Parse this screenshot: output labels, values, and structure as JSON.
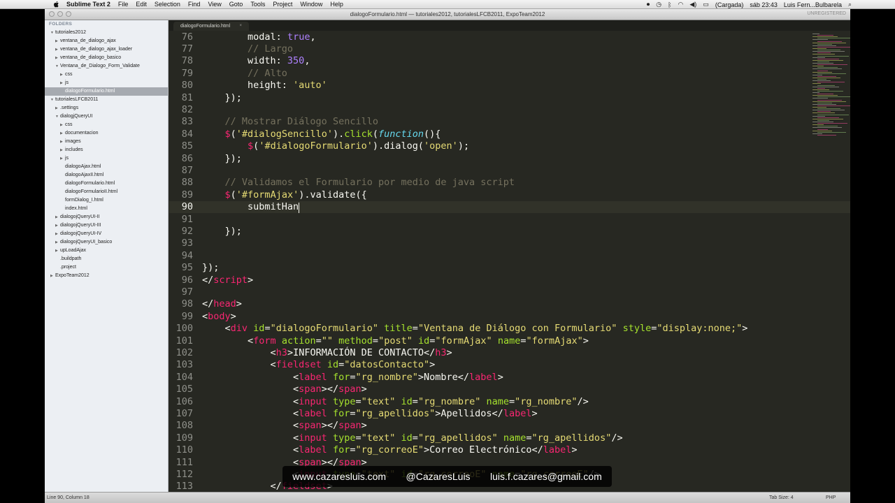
{
  "menubar": {
    "app": "Sublime Text 2",
    "items": [
      "File",
      "Edit",
      "Selection",
      "Find",
      "View",
      "Goto",
      "Tools",
      "Project",
      "Window",
      "Help"
    ],
    "battery": "(Cargada)",
    "clock": "sáb 23:43",
    "user": "Luis Fern...Bulbarela"
  },
  "window": {
    "title": "dialogoFormulario.html — tutoriales2012, tutorialesLFCB2011, ExpoTeam2012",
    "unregistered": "UNREGISTERED"
  },
  "sidebar": {
    "header": "FOLDERS",
    "items": [
      {
        "label": "tutoriales2012",
        "depth": 0,
        "open": true
      },
      {
        "label": "ventana_de_dialogo_ajax",
        "depth": 1,
        "open": false
      },
      {
        "label": "ventana_de_dialogo_ajax_loader",
        "depth": 1,
        "open": false
      },
      {
        "label": "ventana_de_dialogo_basico",
        "depth": 1,
        "open": false
      },
      {
        "label": "Ventana_de_Dialogo_Form_Validate",
        "depth": 1,
        "open": true
      },
      {
        "label": "css",
        "depth": 2,
        "open": false
      },
      {
        "label": "js",
        "depth": 2,
        "open": false
      },
      {
        "label": "dialogoFormulario.html",
        "depth": 2,
        "file": true,
        "selected": true
      },
      {
        "label": "tutorialesLFCB2011",
        "depth": 0,
        "open": true
      },
      {
        "label": ".settings",
        "depth": 1,
        "open": false
      },
      {
        "label": "dialogjQueryUI",
        "depth": 1,
        "open": true
      },
      {
        "label": "css",
        "depth": 2,
        "open": false
      },
      {
        "label": "documentacion",
        "depth": 2,
        "open": false
      },
      {
        "label": "images",
        "depth": 2,
        "open": false
      },
      {
        "label": "includes",
        "depth": 2,
        "open": false
      },
      {
        "label": "js",
        "depth": 2,
        "open": false
      },
      {
        "label": "dialogoAjax.html",
        "depth": 2,
        "file": true
      },
      {
        "label": "dialogoAjaxII.html",
        "depth": 2,
        "file": true
      },
      {
        "label": "dialogoFormulario.html",
        "depth": 2,
        "file": true
      },
      {
        "label": "dialogoFormularioII.html",
        "depth": 2,
        "file": true
      },
      {
        "label": "formDialog_I.html",
        "depth": 2,
        "file": true
      },
      {
        "label": "index.html",
        "depth": 2,
        "file": true
      },
      {
        "label": "dialogojQueryUI-II",
        "depth": 1,
        "open": false
      },
      {
        "label": "dialogojQueryUI-III",
        "depth": 1,
        "open": false
      },
      {
        "label": "dialogojQueryUI-IV",
        "depth": 1,
        "open": false
      },
      {
        "label": "dialogojQueryUI_basico",
        "depth": 1,
        "open": false
      },
      {
        "label": "upLoadAjax",
        "depth": 1,
        "open": false
      },
      {
        "label": ".buildpath",
        "depth": 1,
        "file": true
      },
      {
        "label": ".project",
        "depth": 1,
        "file": true
      },
      {
        "label": "ExpoTeam2012",
        "depth": 0,
        "open": false
      }
    ]
  },
  "tab": {
    "label": "dialogoFormulario.html",
    "close": "×"
  },
  "editor": {
    "current_line": 90,
    "lines": [
      {
        "n": "76",
        "html": "        <span class=\"pl\">modal: </span><span class=\"kw\">true</span>,"
      },
      {
        "n": "77",
        "html": "        <span class=\"cm\">// Largo</span>"
      },
      {
        "n": "78",
        "html": "        width: <span class=\"kw\">350</span>,"
      },
      {
        "n": "79",
        "html": "        <span class=\"cm\">// Alto</span>"
      },
      {
        "n": "80",
        "html": "        height: <span class=\"str\">'auto'</span>"
      },
      {
        "n": "81",
        "html": "    });"
      },
      {
        "n": "82",
        "html": ""
      },
      {
        "n": "83",
        "html": "    <span class=\"cm\">// Mostrar Diálogo Sencillo</span>"
      },
      {
        "n": "84",
        "html": "    <span class=\"tag\">$</span>(<span class=\"str\">'#dialogSencillo'</span>).<span class=\"attr\">click</span>(<span class=\"fn\">function</span>(){"
      },
      {
        "n": "85",
        "html": "        <span class=\"tag\">$</span>(<span class=\"str\">'#dialogoFormulario'</span>).dialog(<span class=\"str\">'open'</span>);"
      },
      {
        "n": "86",
        "html": "    });"
      },
      {
        "n": "87",
        "html": ""
      },
      {
        "n": "88",
        "html": "    <span class=\"cm\">// Validamos el Formulario por medio de java script</span>"
      },
      {
        "n": "89",
        "html": "    <span class=\"tag\">$</span>(<span class=\"str\">'#formAjax'</span>).validate({"
      },
      {
        "n": "90",
        "html": "        submitHan"
      },
      {
        "n": "91",
        "html": ""
      },
      {
        "n": "92",
        "html": "    });"
      },
      {
        "n": "93",
        "html": ""
      },
      {
        "n": "94",
        "html": ""
      },
      {
        "n": "95",
        "html": "});"
      },
      {
        "n": "96",
        "html": "&lt;/<span class=\"tag\">script</span>&gt;"
      },
      {
        "n": "97",
        "html": ""
      },
      {
        "n": "98",
        "html": "&lt;/<span class=\"tag\">head</span>&gt;"
      },
      {
        "n": "99",
        "html": "&lt;<span class=\"tag\">body</span>&gt;"
      },
      {
        "n": "100",
        "html": "    &lt;<span class=\"tag\">div</span> <span class=\"attr\">id</span>=<span class=\"str\">\"dialogoFormulario\"</span> <span class=\"attr\">title</span>=<span class=\"str\">\"Ventana de Diálogo con Formulario\"</span> <span class=\"attr\">style</span>=<span class=\"str\">\"display:none;\"</span>&gt;"
      },
      {
        "n": "101",
        "html": "        &lt;<span class=\"tag\">form</span> <span class=\"attr\">action</span>=<span class=\"str\">\"\"</span> <span class=\"attr\">method</span>=<span class=\"str\">\"post\"</span> <span class=\"attr\">id</span>=<span class=\"str\">\"formAjax\"</span> <span class=\"attr\">name</span>=<span class=\"str\">\"formAjax\"</span>&gt;"
      },
      {
        "n": "102",
        "html": "            &lt;<span class=\"tag\">h3</span>&gt;INFORMACIÓN DE CONTACTO&lt;/<span class=\"tag\">h3</span>&gt;"
      },
      {
        "n": "103",
        "html": "            &lt;<span class=\"tag\">fieldset</span> <span class=\"attr\">id</span>=<span class=\"str\">\"datosContacto\"</span>&gt;"
      },
      {
        "n": "104",
        "html": "                &lt;<span class=\"tag\">label</span> <span class=\"attr\">for</span>=<span class=\"str\">\"rg_nombre\"</span>&gt;Nombre&lt;/<span class=\"tag\">label</span>&gt;"
      },
      {
        "n": "105",
        "html": "                &lt;<span class=\"tag\">span</span>&gt;&lt;/<span class=\"tag\">span</span>&gt;"
      },
      {
        "n": "106",
        "html": "                &lt;<span class=\"tag\">input</span> <span class=\"attr\">type</span>=<span class=\"str\">\"text\"</span> <span class=\"attr\">id</span>=<span class=\"str\">\"rg_nombre\"</span> <span class=\"attr\">name</span>=<span class=\"str\">\"rg_nombre\"</span>/&gt;"
      },
      {
        "n": "107",
        "html": "                &lt;<span class=\"tag\">label</span> <span class=\"attr\">for</span>=<span class=\"str\">\"rg_apellidos\"</span>&gt;Apellidos&lt;/<span class=\"tag\">label</span>&gt;"
      },
      {
        "n": "108",
        "html": "                &lt;<span class=\"tag\">span</span>&gt;&lt;/<span class=\"tag\">span</span>&gt;"
      },
      {
        "n": "109",
        "html": "                &lt;<span class=\"tag\">input</span> <span class=\"attr\">type</span>=<span class=\"str\">\"text\"</span> <span class=\"attr\">id</span>=<span class=\"str\">\"rg_apellidos\"</span> <span class=\"attr\">name</span>=<span class=\"str\">\"rg_apellidos\"</span>/&gt;"
      },
      {
        "n": "110",
        "html": "                &lt;<span class=\"tag\">label</span> <span class=\"attr\">for</span>=<span class=\"str\">\"rg_correoE\"</span>&gt;Correo Electrónico&lt;/<span class=\"tag\">label</span>&gt;"
      },
      {
        "n": "111",
        "html": "                &lt;<span class=\"tag\">span</span>&gt;&lt;/<span class=\"tag\">span</span>&gt;"
      },
      {
        "n": "112",
        "html": "                &lt;<span class=\"tag\">input</span> <span class=\"attr\">type</span>=<span class=\"str\">\"text\"</span> <span class=\"attr\">id</span>=<span class=\"str\">\"rg_correoE\"</span> <span class=\"attr\">name</span>=<span class=\"str\">\"rg_correoE\"</span>/&gt;"
      },
      {
        "n": "113",
        "html": "            &lt;/<span class=\"tag\">fieldset</span>&gt;"
      }
    ]
  },
  "status": {
    "position": "Line 90, Column 18",
    "tab_size": "Tab Size: 4",
    "syntax": "PHP"
  },
  "watermark": {
    "site": "www.cazaresluis.com",
    "twitter": "@CazaresLuis",
    "email": "luis.f.cazares@gmail.com"
  },
  "colors": {
    "editor_bg": "#272822",
    "keyword": "#ae81ff",
    "string": "#e6db74",
    "comment": "#75715e",
    "tag": "#f92672",
    "attribute": "#a6e22e"
  }
}
